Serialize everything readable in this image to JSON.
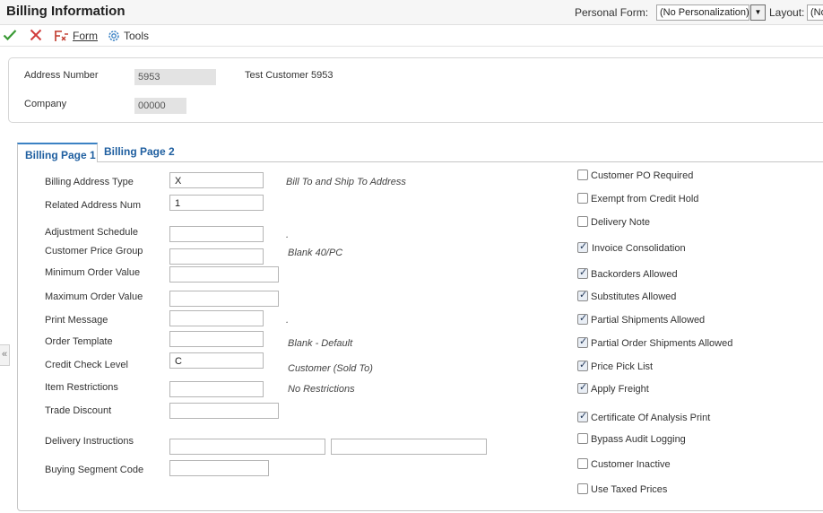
{
  "header": {
    "title": "Billing Information",
    "personal_form_label": "Personal Form:",
    "personal_form_value": "(No Personalization)",
    "layout_label": "Layout:",
    "layout_value": "(No"
  },
  "toolbar": {
    "ok_icon": "checkmark-icon",
    "cancel_icon": "x-icon",
    "form_label": "Form",
    "tools_label": "Tools"
  },
  "customer": {
    "address_number_label": "Address Number",
    "address_number": "5953",
    "customer_name": "Test Customer 5953",
    "company_label": "Company",
    "company": "00000"
  },
  "tabs": [
    {
      "label": "Billing Page 1",
      "active": true
    },
    {
      "label": "Billing Page 2",
      "active": false
    }
  ],
  "fields": {
    "billing_address_type": {
      "label": "Billing Address Type",
      "value": "X",
      "desc": "Bill To and Ship To Address"
    },
    "related_address_num": {
      "label": "Related Address Num",
      "value": "1"
    },
    "adjustment_schedule": {
      "label": "Adjustment Schedule",
      "value": "",
      "desc": "."
    },
    "customer_price_group": {
      "label": "Customer Price Group",
      "value": "",
      "desc": "Blank 40/PC"
    },
    "minimum_order_value": {
      "label": "Minimum Order Value",
      "value": ""
    },
    "maximum_order_value": {
      "label": "Maximum Order Value",
      "value": ""
    },
    "print_message": {
      "label": "Print Message",
      "value": "",
      "desc": "."
    },
    "order_template": {
      "label": "Order Template",
      "value": "",
      "desc": "Blank - Default"
    },
    "credit_check_level": {
      "label": "Credit Check Level",
      "value": "C",
      "desc": "Customer (Sold To)"
    },
    "item_restrictions": {
      "label": "Item Restrictions",
      "value": "",
      "desc": "No Restrictions"
    },
    "trade_discount": {
      "label": "Trade Discount",
      "value": ""
    },
    "delivery_instructions": {
      "label": "Delivery Instructions",
      "value1": "",
      "value2": ""
    },
    "buying_segment_code": {
      "label": "Buying Segment Code",
      "value": ""
    }
  },
  "checkboxes": [
    {
      "label": "Customer PO Required",
      "checked": false
    },
    {
      "label": "Exempt from Credit Hold",
      "checked": false
    },
    {
      "label": "Delivery Note",
      "checked": false
    },
    {
      "label": "Invoice Consolidation",
      "checked": true
    },
    {
      "label": "Backorders Allowed",
      "checked": true
    },
    {
      "label": "Substitutes Allowed",
      "checked": true
    },
    {
      "label": "Partial Shipments Allowed",
      "checked": true
    },
    {
      "label": "Partial Order Shipments Allowed",
      "checked": true
    },
    {
      "label": "Price Pick List",
      "checked": true
    },
    {
      "label": "Apply Freight",
      "checked": true
    },
    {
      "label": "Certificate Of Analysis Print",
      "checked": true
    },
    {
      "label": "Bypass Audit Logging",
      "checked": false
    },
    {
      "label": "Customer Inactive",
      "checked": false
    },
    {
      "label": "Use Taxed Prices",
      "checked": false
    }
  ],
  "collapse_handle": "«"
}
